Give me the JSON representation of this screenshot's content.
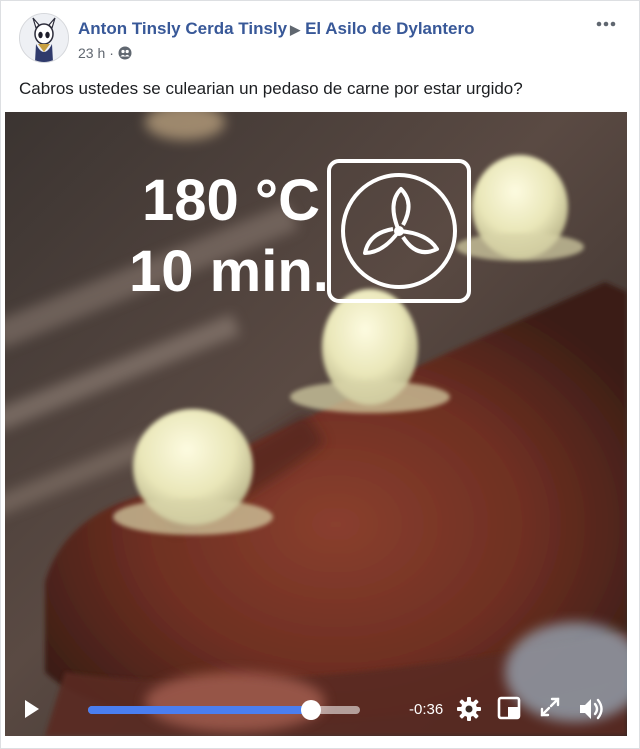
{
  "post": {
    "author": "Anton Tinsly Cerda Tinsly",
    "group": "El Asilo de Dylantero",
    "timestamp": "23 h",
    "separator": "·",
    "text": "Cabros ustedes se culearian un pedaso de carne por estar urgido?"
  },
  "video": {
    "overlay_temperature": "180 °C",
    "overlay_duration": "10 min.",
    "time_remaining": "-0:36",
    "progress": 0.82,
    "buffered": 1.0
  },
  "icons": {
    "more": "more-options-icon",
    "group": "group-audience-icon",
    "play": "play-icon",
    "settings": "gear-icon",
    "pip": "picture-in-picture-icon",
    "fullscreen": "fullscreen-icon",
    "volume": "volume-icon",
    "fan": "convection-fan-icon"
  },
  "colors": {
    "link": "#385898",
    "meta": "#606770",
    "progress": "#4a7ef0"
  }
}
